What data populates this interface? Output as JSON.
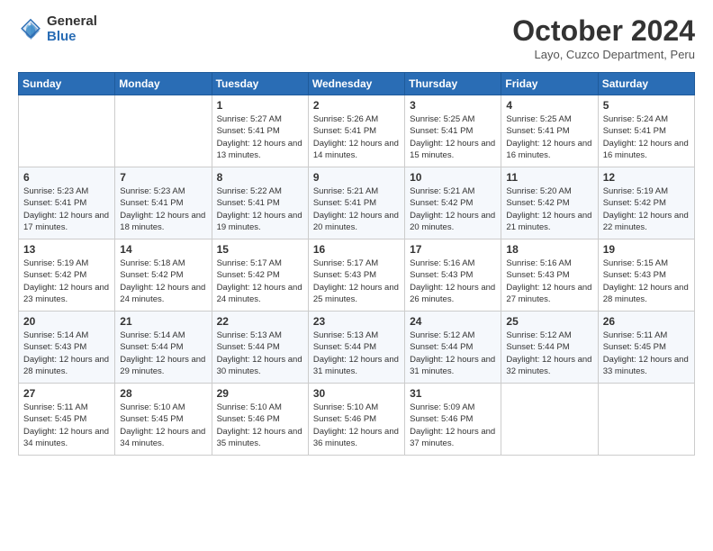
{
  "header": {
    "logo": {
      "general": "General",
      "blue": "Blue"
    },
    "title": "October 2024",
    "location": "Layo, Cuzco Department, Peru"
  },
  "days_of_week": [
    "Sunday",
    "Monday",
    "Tuesday",
    "Wednesday",
    "Thursday",
    "Friday",
    "Saturday"
  ],
  "weeks": [
    [
      {
        "date": "",
        "sunrise": "",
        "sunset": "",
        "daylight": ""
      },
      {
        "date": "",
        "sunrise": "",
        "sunset": "",
        "daylight": ""
      },
      {
        "date": "1",
        "sunrise": "Sunrise: 5:27 AM",
        "sunset": "Sunset: 5:41 PM",
        "daylight": "Daylight: 12 hours and 13 minutes."
      },
      {
        "date": "2",
        "sunrise": "Sunrise: 5:26 AM",
        "sunset": "Sunset: 5:41 PM",
        "daylight": "Daylight: 12 hours and 14 minutes."
      },
      {
        "date": "3",
        "sunrise": "Sunrise: 5:25 AM",
        "sunset": "Sunset: 5:41 PM",
        "daylight": "Daylight: 12 hours and 15 minutes."
      },
      {
        "date": "4",
        "sunrise": "Sunrise: 5:25 AM",
        "sunset": "Sunset: 5:41 PM",
        "daylight": "Daylight: 12 hours and 16 minutes."
      },
      {
        "date": "5",
        "sunrise": "Sunrise: 5:24 AM",
        "sunset": "Sunset: 5:41 PM",
        "daylight": "Daylight: 12 hours and 16 minutes."
      }
    ],
    [
      {
        "date": "6",
        "sunrise": "Sunrise: 5:23 AM",
        "sunset": "Sunset: 5:41 PM",
        "daylight": "Daylight: 12 hours and 17 minutes."
      },
      {
        "date": "7",
        "sunrise": "Sunrise: 5:23 AM",
        "sunset": "Sunset: 5:41 PM",
        "daylight": "Daylight: 12 hours and 18 minutes."
      },
      {
        "date": "8",
        "sunrise": "Sunrise: 5:22 AM",
        "sunset": "Sunset: 5:41 PM",
        "daylight": "Daylight: 12 hours and 19 minutes."
      },
      {
        "date": "9",
        "sunrise": "Sunrise: 5:21 AM",
        "sunset": "Sunset: 5:41 PM",
        "daylight": "Daylight: 12 hours and 20 minutes."
      },
      {
        "date": "10",
        "sunrise": "Sunrise: 5:21 AM",
        "sunset": "Sunset: 5:42 PM",
        "daylight": "Daylight: 12 hours and 20 minutes."
      },
      {
        "date": "11",
        "sunrise": "Sunrise: 5:20 AM",
        "sunset": "Sunset: 5:42 PM",
        "daylight": "Daylight: 12 hours and 21 minutes."
      },
      {
        "date": "12",
        "sunrise": "Sunrise: 5:19 AM",
        "sunset": "Sunset: 5:42 PM",
        "daylight": "Daylight: 12 hours and 22 minutes."
      }
    ],
    [
      {
        "date": "13",
        "sunrise": "Sunrise: 5:19 AM",
        "sunset": "Sunset: 5:42 PM",
        "daylight": "Daylight: 12 hours and 23 minutes."
      },
      {
        "date": "14",
        "sunrise": "Sunrise: 5:18 AM",
        "sunset": "Sunset: 5:42 PM",
        "daylight": "Daylight: 12 hours and 24 minutes."
      },
      {
        "date": "15",
        "sunrise": "Sunrise: 5:17 AM",
        "sunset": "Sunset: 5:42 PM",
        "daylight": "Daylight: 12 hours and 24 minutes."
      },
      {
        "date": "16",
        "sunrise": "Sunrise: 5:17 AM",
        "sunset": "Sunset: 5:43 PM",
        "daylight": "Daylight: 12 hours and 25 minutes."
      },
      {
        "date": "17",
        "sunrise": "Sunrise: 5:16 AM",
        "sunset": "Sunset: 5:43 PM",
        "daylight": "Daylight: 12 hours and 26 minutes."
      },
      {
        "date": "18",
        "sunrise": "Sunrise: 5:16 AM",
        "sunset": "Sunset: 5:43 PM",
        "daylight": "Daylight: 12 hours and 27 minutes."
      },
      {
        "date": "19",
        "sunrise": "Sunrise: 5:15 AM",
        "sunset": "Sunset: 5:43 PM",
        "daylight": "Daylight: 12 hours and 28 minutes."
      }
    ],
    [
      {
        "date": "20",
        "sunrise": "Sunrise: 5:14 AM",
        "sunset": "Sunset: 5:43 PM",
        "daylight": "Daylight: 12 hours and 28 minutes."
      },
      {
        "date": "21",
        "sunrise": "Sunrise: 5:14 AM",
        "sunset": "Sunset: 5:44 PM",
        "daylight": "Daylight: 12 hours and 29 minutes."
      },
      {
        "date": "22",
        "sunrise": "Sunrise: 5:13 AM",
        "sunset": "Sunset: 5:44 PM",
        "daylight": "Daylight: 12 hours and 30 minutes."
      },
      {
        "date": "23",
        "sunrise": "Sunrise: 5:13 AM",
        "sunset": "Sunset: 5:44 PM",
        "daylight": "Daylight: 12 hours and 31 minutes."
      },
      {
        "date": "24",
        "sunrise": "Sunrise: 5:12 AM",
        "sunset": "Sunset: 5:44 PM",
        "daylight": "Daylight: 12 hours and 31 minutes."
      },
      {
        "date": "25",
        "sunrise": "Sunrise: 5:12 AM",
        "sunset": "Sunset: 5:44 PM",
        "daylight": "Daylight: 12 hours and 32 minutes."
      },
      {
        "date": "26",
        "sunrise": "Sunrise: 5:11 AM",
        "sunset": "Sunset: 5:45 PM",
        "daylight": "Daylight: 12 hours and 33 minutes."
      }
    ],
    [
      {
        "date": "27",
        "sunrise": "Sunrise: 5:11 AM",
        "sunset": "Sunset: 5:45 PM",
        "daylight": "Daylight: 12 hours and 34 minutes."
      },
      {
        "date": "28",
        "sunrise": "Sunrise: 5:10 AM",
        "sunset": "Sunset: 5:45 PM",
        "daylight": "Daylight: 12 hours and 34 minutes."
      },
      {
        "date": "29",
        "sunrise": "Sunrise: 5:10 AM",
        "sunset": "Sunset: 5:46 PM",
        "daylight": "Daylight: 12 hours and 35 minutes."
      },
      {
        "date": "30",
        "sunrise": "Sunrise: 5:10 AM",
        "sunset": "Sunset: 5:46 PM",
        "daylight": "Daylight: 12 hours and 36 minutes."
      },
      {
        "date": "31",
        "sunrise": "Sunrise: 5:09 AM",
        "sunset": "Sunset: 5:46 PM",
        "daylight": "Daylight: 12 hours and 37 minutes."
      },
      {
        "date": "",
        "sunrise": "",
        "sunset": "",
        "daylight": ""
      },
      {
        "date": "",
        "sunrise": "",
        "sunset": "",
        "daylight": ""
      }
    ]
  ]
}
